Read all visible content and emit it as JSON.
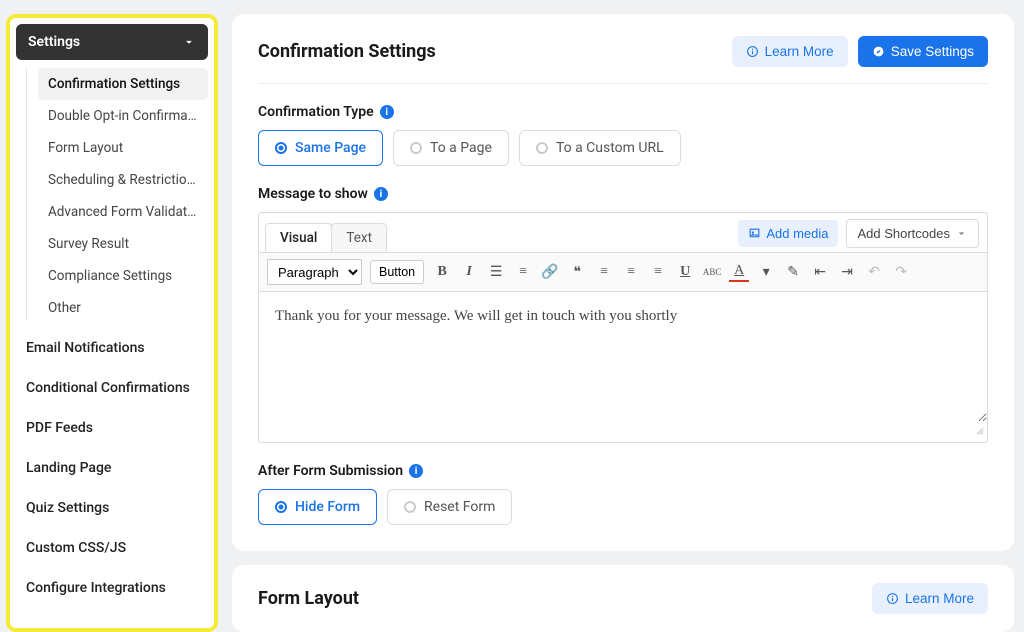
{
  "sidebar": {
    "header": "Settings",
    "sub": [
      "Confirmation Settings",
      "Double Opt-in Confirma...",
      "Form Layout",
      "Scheduling & Restrictions",
      "Advanced Form Validati...",
      "Survey Result",
      "Compliance Settings",
      "Other"
    ],
    "activeSub": 0,
    "items": [
      "Email Notifications",
      "Conditional Confirmations",
      "PDF Feeds",
      "Landing Page",
      "Quiz Settings",
      "Custom CSS/JS",
      "Configure Integrations"
    ]
  },
  "panel1": {
    "title": "Confirmation Settings",
    "learn": "Learn More",
    "save": "Save Settings",
    "confType": "Confirmation Type",
    "radios": [
      "Same Page",
      "To a Page",
      "To a Custom URL"
    ],
    "radioSel": 0,
    "msgLabel": "Message to show",
    "editor": {
      "tabVisual": "Visual",
      "tabText": "Text",
      "addMedia": "Add media",
      "addShort": "Add Shortcodes",
      "paragraph": "Paragraph",
      "button": "Button",
      "body": "Thank you for your message. We will get in touch with you shortly"
    },
    "afterLabel": "After Form Submission",
    "afterRadios": [
      "Hide Form",
      "Reset Form"
    ],
    "afterSel": 0
  },
  "panel2": {
    "title": "Form Layout",
    "learn": "Learn More"
  }
}
